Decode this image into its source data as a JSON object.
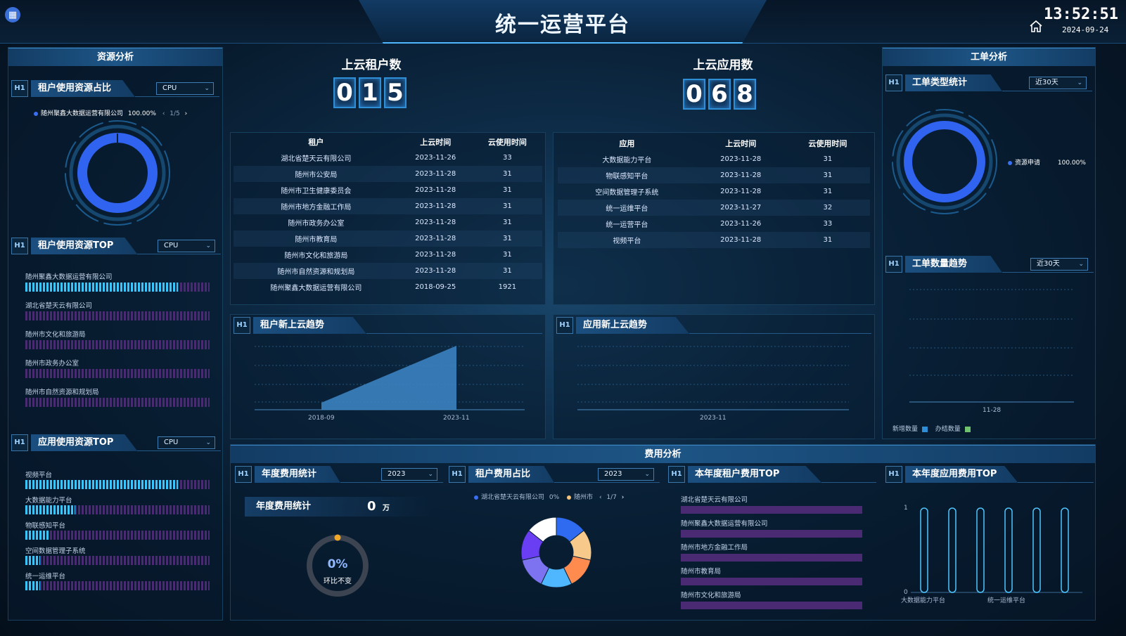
{
  "header": {
    "title": "统一运营平台",
    "time": "13:52:51",
    "date": "2024-09-24"
  },
  "left": {
    "section_title": "资源分析",
    "tenant_share": {
      "title": "租户使用资源占比",
      "select": "CPU",
      "legend_name": "随州聚鑫大数据运营有限公司",
      "legend_value": "100.00%",
      "pager": "1/5"
    },
    "tenant_top": {
      "title": "租户使用资源TOP",
      "select": "CPU",
      "items": [
        {
          "label": "随州聚鑫大数据运营有限公司",
          "value": 0.83
        },
        {
          "label": "湖北省楚天云有限公司",
          "value": 0.0
        },
        {
          "label": "随州市文化和旅游局",
          "value": 0.0
        },
        {
          "label": "随州市政务办公室",
          "value": 0.0
        },
        {
          "label": "随州市自然资源和规划局",
          "value": 0.0
        }
      ]
    },
    "app_top": {
      "title": "应用使用资源TOP",
      "select": "CPU",
      "items": [
        {
          "label": "视频平台",
          "value": 0.83
        },
        {
          "label": "大数据能力平台",
          "value": 0.27
        },
        {
          "label": "物联感知平台",
          "value": 0.13
        },
        {
          "label": "空间数据管理子系统",
          "value": 0.08
        },
        {
          "label": "统一运维平台",
          "value": 0.08
        }
      ]
    }
  },
  "center": {
    "tenant_count": {
      "title": "上云租户数",
      "digits": [
        "0",
        "1",
        "5"
      ]
    },
    "app_count": {
      "title": "上云应用数",
      "digits": [
        "0",
        "6",
        "8"
      ]
    },
    "tenant_table": {
      "headers": [
        "租户",
        "上云时间",
        "云使用时间"
      ],
      "rows": [
        [
          "湖北省楚天云有限公司",
          "2023-11-26",
          "33"
        ],
        [
          "随州市公安局",
          "2023-11-28",
          "31"
        ],
        [
          "随州市卫生健康委员会",
          "2023-11-28",
          "31"
        ],
        [
          "随州市地方金融工作局",
          "2023-11-28",
          "31"
        ],
        [
          "随州市政务办公室",
          "2023-11-28",
          "31"
        ],
        [
          "随州市教育局",
          "2023-11-28",
          "31"
        ],
        [
          "随州市文化和旅游局",
          "2023-11-28",
          "31"
        ],
        [
          "随州市自然资源和规划局",
          "2023-11-28",
          "31"
        ],
        [
          "随州聚鑫大数据运营有限公司",
          "2018-09-25",
          "1921"
        ]
      ]
    },
    "app_table": {
      "headers": [
        "应用",
        "上云时间",
        "云使用时间"
      ],
      "rows": [
        [
          "大数据能力平台",
          "2023-11-28",
          "31"
        ],
        [
          "物联感知平台",
          "2023-11-28",
          "31"
        ],
        [
          "空间数据管理子系统",
          "2023-11-28",
          "31"
        ],
        [
          "统一运维平台",
          "2023-11-27",
          "32"
        ],
        [
          "统一运营平台",
          "2023-11-26",
          "33"
        ],
        [
          "视频平台",
          "2023-11-28",
          "31"
        ]
      ]
    },
    "tenant_trend": {
      "title": "租户新上云趋势",
      "x_labels": [
        "2018-09",
        "2023-11"
      ]
    },
    "app_trend": {
      "title": "应用新上云趋势",
      "x_labels": [
        "2023-11"
      ]
    }
  },
  "right": {
    "section_title": "工单分析",
    "type_stats": {
      "title": "工单类型统计",
      "select": "近30天",
      "legend_name": "资源申请",
      "legend_value": "100.00%"
    },
    "count_trend": {
      "title": "工单数量趋势",
      "select": "近30天",
      "x_label": "11-28",
      "legend_new": "新增数量",
      "legend_done": "办结数量"
    }
  },
  "cost": {
    "section_title": "费用分析",
    "annual": {
      "title": "年度费用统计",
      "select": "2023",
      "label": "年度费用统计",
      "value": "0",
      "unit": "万",
      "ring_pct": "0%",
      "ring_sub": "环比不变"
    },
    "tenant_share": {
      "title": "租户费用占比",
      "select": "2023",
      "legend1": "湖北省楚天云有限公司",
      "legend1_val": "0%",
      "legend2": "随州市",
      "pager": "1/7"
    },
    "tenant_top": {
      "title": "本年度租户费用TOP",
      "items": [
        "湖北省楚天云有限公司",
        "随州聚鑫大数据运营有限公司",
        "随州市地方金融工作局",
        "随州市教育局",
        "随州市文化和旅游局"
      ]
    },
    "app_top": {
      "title": "本年度应用费用TOP",
      "y_labels": [
        "1",
        "0"
      ],
      "x_labels": [
        "大数据能力平台",
        "统一运维平台"
      ]
    }
  },
  "chart_data": [
    {
      "type": "pie",
      "title": "租户使用资源占比",
      "categories": [
        "随州聚鑫大数据运营有限公司"
      ],
      "values": [
        100.0
      ]
    },
    {
      "type": "area",
      "title": "租户新上云趋势",
      "x": [
        "2018-09",
        "2023-11"
      ],
      "values": [
        1,
        15
      ]
    },
    {
      "type": "pie",
      "title": "工单类型统计",
      "categories": [
        "资源申请"
      ],
      "values": [
        100.0
      ]
    },
    {
      "type": "pie",
      "title": "租户费用占比",
      "categories": [
        "湖北省楚天云有限公司",
        "随州市"
      ],
      "values": [
        0,
        0
      ]
    }
  ]
}
